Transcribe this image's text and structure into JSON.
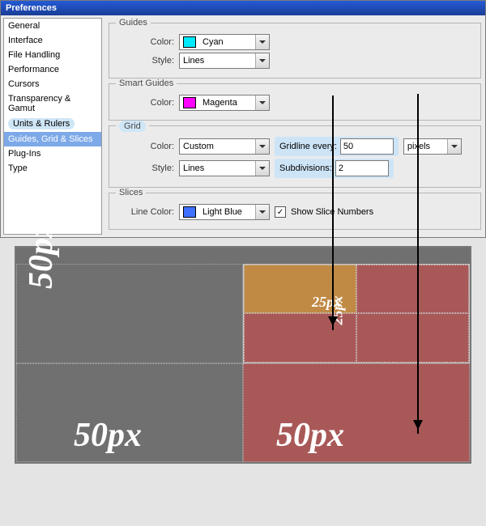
{
  "window": {
    "title": "Preferences"
  },
  "sidebar": {
    "items": [
      "General",
      "Interface",
      "File Handling",
      "Performance",
      "Cursors",
      "Transparency & Gamut",
      "Units & Rulers",
      "Guides, Grid & Slices",
      "Plug-Ins",
      "Type"
    ],
    "selectedIndex": 7,
    "highlightIndex": 6
  },
  "guides": {
    "legend": "Guides",
    "colorLabel": "Color:",
    "color": "Cyan",
    "colorHex": "#00eaff",
    "styleLabel": "Style:",
    "style": "Lines"
  },
  "smart": {
    "legend": "Smart Guides",
    "colorLabel": "Color:",
    "color": "Magenta",
    "colorHex": "#ff00ff"
  },
  "grid": {
    "legend": "Grid",
    "colorLabel": "Color:",
    "color": "Custom",
    "styleLabel": "Style:",
    "style": "Lines",
    "gridlineLabel": "Gridline every:",
    "gridlineValue": "50",
    "unit": "pixels",
    "subdivLabel": "Subdivisions:",
    "subdivValue": "2"
  },
  "slices": {
    "legend": "Slices",
    "lineColorLabel": "Line Color:",
    "lineColor": "Light Blue",
    "lineColorHex": "#4070ff",
    "showNumbers": true,
    "showNumbersLabel": "Show Slice Numbers"
  },
  "illus": {
    "big": "50px",
    "small": "25px"
  }
}
